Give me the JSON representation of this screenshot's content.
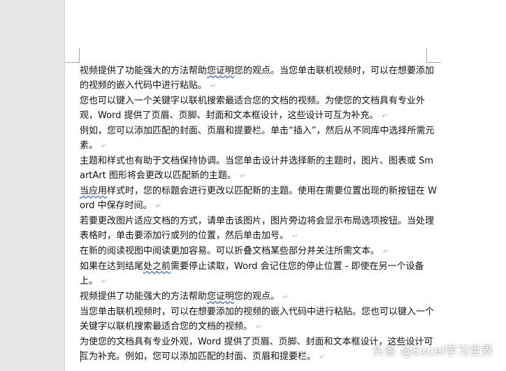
{
  "document": {
    "paragraphs": [
      {
        "pre": "视频提供了功能强大的方法帮助",
        "squiggle": "您证明",
        "post": "您的观点。当您单击联机视频时，可以在想要添加的视频的嵌入代码中进行粘贴。"
      },
      {
        "pre": "您也可以键入一个关键字以联机搜索最适合您的文档的视频。为使您的文档具有专业外观，Word 提供了页眉、页脚、封面和文本框设计，这些设计可互为补充。",
        "squiggle": "",
        "post": ""
      },
      {
        "pre": "例如，您可以添加匹配的封面、页眉和提要栏。单击“插入”，然后从不同库中选择所需元素。",
        "squiggle": "",
        "post": ""
      },
      {
        "pre": "主题和样式也有助于文档保持协调。当您单击设计并选择新的主题时，图片、图表或 SmartArt 图形将会更改以匹配新的主题。",
        "squiggle": "",
        "post": ""
      },
      {
        "pre": "",
        "squiggle": "当应用",
        "post": "样式时，您的标题会进行更改以匹配新的主题。使用在需要位置出现的新按钮在 Word 中保存时间。"
      },
      {
        "pre": "若要更改图片适应文档的方式，请单击该图片，图片旁边将会显示布局选项按钮。当处理表格时，单击要添加行或列的位置，然后单击加号。",
        "squiggle": "",
        "post": ""
      },
      {
        "pre": "在新的阅读视图中阅读更加容易。可以折叠文档某些部分并关注所需文本。",
        "squiggle": "",
        "post": ""
      },
      {
        "pre": "如果在达到结尾",
        "squiggle": "处之前",
        "post": "需要停止读取，Word 会记住您的停止位置 - 即使在另一个设备上。"
      },
      {
        "pre": "视频提供了功能强大的方法帮助",
        "squiggle": "您证明",
        "post": "您的观点。"
      },
      {
        "pre": "当您单击联机视频时，可以在想要添加的视频的嵌入代码中进行粘贴。您也可以键入一个关键字以联机搜索最适合您的文档的视频。",
        "squiggle": "",
        "post": ""
      },
      {
        "pre": "为使您的文档具有专业外观，Word 提供了页眉、页脚、封面和文本框设计，这些设计可互为补充。例如，您可以添加匹配的封面、页眉和提要栏。",
        "squiggle": "",
        "post": ""
      }
    ],
    "paragraph_mark": "↵"
  },
  "watermark": {
    "text": "头条 @Excel学习世界"
  },
  "colors": {
    "page": "#ffffff",
    "background": "#e6e6e6",
    "squiggle": "#3b6fd0",
    "paragraph_mark": "#b8b8b8"
  }
}
